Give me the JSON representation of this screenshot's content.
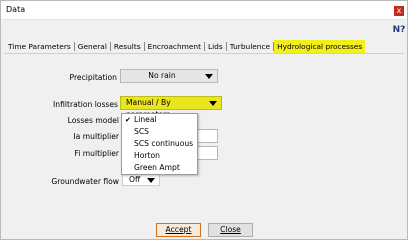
{
  "window": {
    "title": "Data",
    "close_glyph": "x",
    "help_label": "N?"
  },
  "tabs": [
    {
      "label": "Time Parameters",
      "active": false
    },
    {
      "label": "General",
      "active": false
    },
    {
      "label": "Results",
      "active": false
    },
    {
      "label": "Encroachment",
      "active": false
    },
    {
      "label": "Lids",
      "active": false
    },
    {
      "label": "Turbulence",
      "active": false
    },
    {
      "label": "Hydrological processes",
      "active": true
    }
  ],
  "form": {
    "precipitation": {
      "label": "Precipitation",
      "value": "No rain"
    },
    "infiltration": {
      "label": "Infiltration losses",
      "value": "Manual / By parameters"
    },
    "losses_model": {
      "label": "Losses model",
      "value": "Lineal"
    },
    "ia_multiplier": {
      "label": "Ia multiplier",
      "value": ""
    },
    "fi_multiplier": {
      "label": "Fi multiplier",
      "value": ""
    },
    "groundwater": {
      "label": "Groundwater flow",
      "value": "Off"
    }
  },
  "dropdown": {
    "options": [
      {
        "label": "Lineal",
        "selected": true
      },
      {
        "label": "SCS",
        "selected": false
      },
      {
        "label": "SCS continuous",
        "selected": false
      },
      {
        "label": "Horton",
        "selected": false
      },
      {
        "label": "Green Ampt",
        "selected": false
      }
    ],
    "check_glyph": "✔"
  },
  "buttons": {
    "accept": "Accept",
    "close": "Close"
  },
  "colors": {
    "active_tab": "#f2ef1b",
    "close_button": "#c42b1c",
    "accept_border": "#d2701e"
  }
}
